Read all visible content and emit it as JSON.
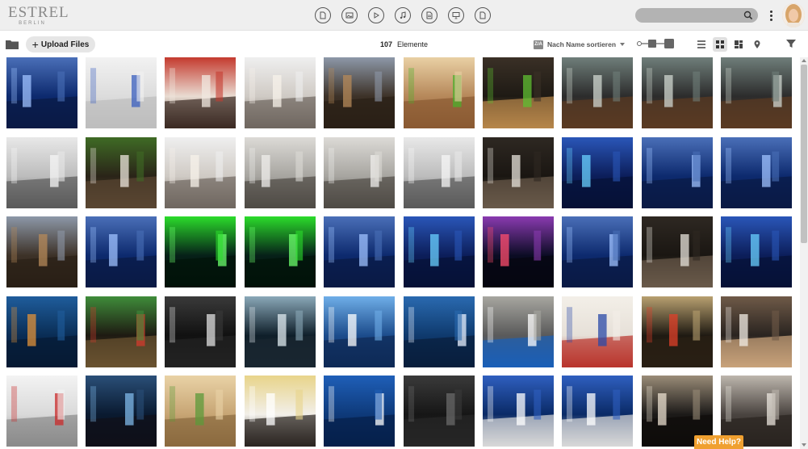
{
  "brand": {
    "logo_main": "ESTREL",
    "logo_sub": "BERLIN"
  },
  "type_filters": [
    {
      "name": "document-icon"
    },
    {
      "name": "image-icon"
    },
    {
      "name": "video-play-icon"
    },
    {
      "name": "music-note-icon"
    },
    {
      "name": "text-file-icon"
    },
    {
      "name": "presentation-icon"
    },
    {
      "name": "file-icon"
    }
  ],
  "search": {
    "placeholder": "",
    "value": ""
  },
  "toolbar": {
    "upload_label": "Upload Files",
    "upload_plus": "+",
    "count_value": "107",
    "count_label": "Elemente",
    "sort_badge": "Z/A",
    "sort_label": "Nach Name sortieren"
  },
  "help_label": "Need Help?",
  "colors": {
    "accent": "#f0a030",
    "header_bg": "#efefef",
    "search_bg": "#b3b3b3"
  },
  "thumbnails": [
    {
      "theme": "blue-atrium"
    },
    {
      "theme": "white-gallery"
    },
    {
      "theme": "red-mural"
    },
    {
      "theme": "white-lobby"
    },
    {
      "theme": "wine-wall"
    },
    {
      "theme": "wood-table-apples"
    },
    {
      "theme": "dark-wood-apples"
    },
    {
      "theme": "wine-room"
    },
    {
      "theme": "wine-room"
    },
    {
      "theme": "wine-room"
    },
    {
      "theme": "grey-lobby"
    },
    {
      "theme": "restaurant-plant"
    },
    {
      "theme": "white-lobby"
    },
    {
      "theme": "grey-lounge"
    },
    {
      "theme": "grey-lounge"
    },
    {
      "theme": "grey-lobby"
    },
    {
      "theme": "dark-sculpture"
    },
    {
      "theme": "blue-art"
    },
    {
      "theme": "blue-atrium"
    },
    {
      "theme": "blue-atrium"
    },
    {
      "theme": "wine-wall"
    },
    {
      "theme": "blue-atrium"
    },
    {
      "theme": "green-lights"
    },
    {
      "theme": "green-lights"
    },
    {
      "theme": "blue-atrium"
    },
    {
      "theme": "blue-art"
    },
    {
      "theme": "dark-neon"
    },
    {
      "theme": "blue-atrium"
    },
    {
      "theme": "dark-sculpture"
    },
    {
      "theme": "blue-art"
    },
    {
      "theme": "blue-corridor"
    },
    {
      "theme": "green-art"
    },
    {
      "theme": "dark-lobby"
    },
    {
      "theme": "dark-glass"
    },
    {
      "theme": "blue-glass"
    },
    {
      "theme": "blue-sign"
    },
    {
      "theme": "blue-fountain"
    },
    {
      "theme": "vase-red"
    },
    {
      "theme": "dark-colorful"
    },
    {
      "theme": "waiter-cake"
    },
    {
      "theme": "kitchen-white"
    },
    {
      "theme": "dark-bar-blue"
    },
    {
      "theme": "sandwiches"
    },
    {
      "theme": "waiter-bar"
    },
    {
      "theme": "blue-lobby"
    },
    {
      "theme": "dark-sofa"
    },
    {
      "theme": "blue-white-lounge"
    },
    {
      "theme": "blue-white-lounge"
    },
    {
      "theme": "dark-facade"
    },
    {
      "theme": "dark-lounge"
    }
  ]
}
